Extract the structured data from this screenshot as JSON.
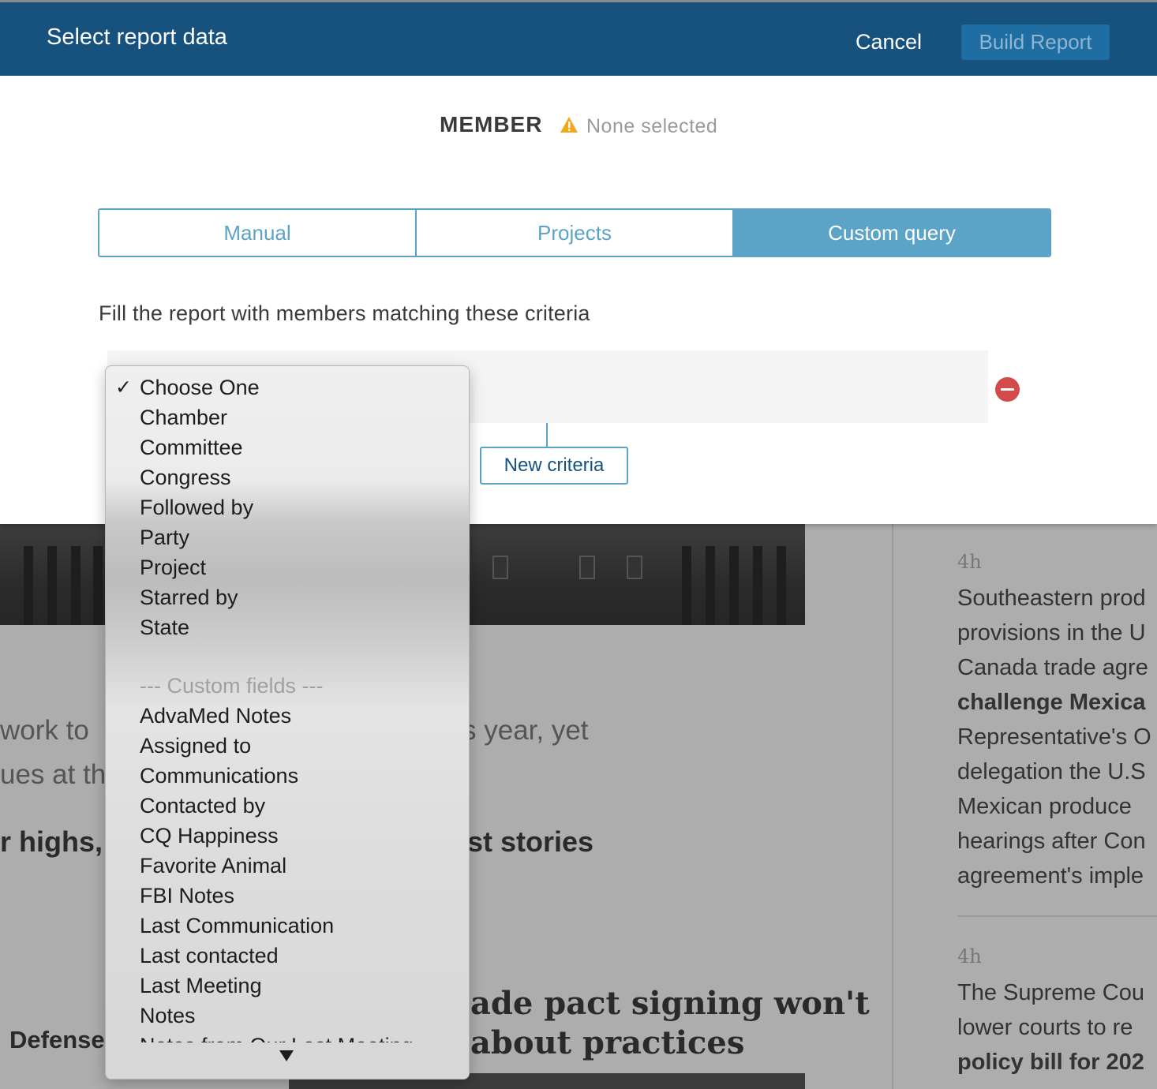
{
  "dialog": {
    "title": "Select report data",
    "cancel_label": "Cancel",
    "build_label": "Build Report",
    "member_label": "MEMBER",
    "member_status": "None selected",
    "tabs": [
      {
        "label": "Manual",
        "active": false
      },
      {
        "label": "Projects",
        "active": false
      },
      {
        "label": "Custom query",
        "active": true
      }
    ],
    "criteria_heading": "Fill the report with members matching these criteria",
    "new_criteria_label": "New criteria"
  },
  "dropdown": {
    "selected": "Choose One",
    "options": [
      "Choose One",
      "Chamber",
      "Committee",
      "Congress",
      "Followed by",
      "Party",
      "Project",
      "Starred by",
      "State"
    ],
    "separator": "--- Custom fields ---",
    "custom_options": [
      "AdvaMed Notes",
      "Assigned to",
      "Communications",
      "Contacted by",
      "CQ Happiness",
      "Favorite Animal",
      "FBI Notes",
      "Last Communication",
      "Last contacted",
      "Last Meeting",
      "Notes",
      "Notes from Our Last Meeting"
    ]
  },
  "background": {
    "snippet1": "work to",
    "snippet2": "ues at th",
    "snippet3": "s year, yet",
    "snippet4": "r highs, l",
    "snippet5": "st stories",
    "snippet6": "Defense",
    "headline_line1": "ade pact signing won't",
    "headline_line2": "about practices",
    "side": {
      "time1": "4h",
      "story1": [
        "Southeastern prod",
        "provisions in the U",
        "Canada trade agre",
        "challenge Mexica",
        "Representative's O",
        "delegation the U.S",
        "Mexican produce",
        "hearings after Con",
        "agreement's imple"
      ],
      "time2": "4h",
      "story2": [
        "The Supreme Cou",
        "lower courts to re",
        "policy bill for 202"
      ]
    }
  }
}
